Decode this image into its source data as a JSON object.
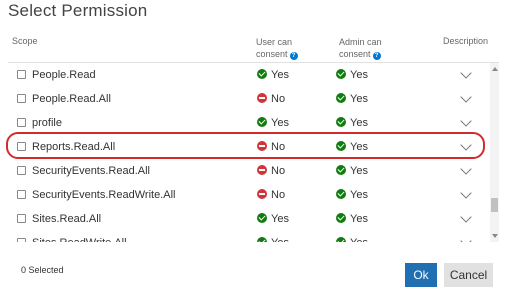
{
  "dialog": {
    "title": "Select Permission"
  },
  "columns": {
    "scope": "Scope",
    "user_consent_line1": "User can",
    "user_consent_line2": "consent",
    "admin_consent_line1": "Admin can",
    "admin_consent_line2": "consent",
    "description": "Description"
  },
  "permissions": [
    {
      "scope": "People.Read",
      "user_can_consent": "Yes",
      "admin_can_consent": "Yes",
      "checked": false
    },
    {
      "scope": "People.Read.All",
      "user_can_consent": "No",
      "admin_can_consent": "Yes",
      "checked": false
    },
    {
      "scope": "profile",
      "user_can_consent": "Yes",
      "admin_can_consent": "Yes",
      "checked": false
    },
    {
      "scope": "Reports.Read.All",
      "user_can_consent": "No",
      "admin_can_consent": "Yes",
      "checked": false,
      "highlighted": true
    },
    {
      "scope": "SecurityEvents.Read.All",
      "user_can_consent": "No",
      "admin_can_consent": "Yes",
      "checked": false
    },
    {
      "scope": "SecurityEvents.ReadWrite.All",
      "user_can_consent": "No",
      "admin_can_consent": "Yes",
      "checked": false
    },
    {
      "scope": "Sites.Read.All",
      "user_can_consent": "Yes",
      "admin_can_consent": "Yes",
      "checked": false
    },
    {
      "scope": "Sites.ReadWrite.All",
      "user_can_consent": "Yes",
      "admin_can_consent": "Yes",
      "checked": false
    }
  ],
  "footer": {
    "selected_count": "0 Selected",
    "ok_label": "Ok",
    "cancel_label": "Cancel"
  },
  "colors": {
    "yes": "#107c10",
    "no": "#d13438",
    "primary_button": "#1f6fb2",
    "highlight_ring": "#d62a2a"
  },
  "icons": {
    "help": "help-circle-icon",
    "yes": "check-circle-icon",
    "no": "blocked-icon",
    "expand": "chevron-down-icon"
  }
}
